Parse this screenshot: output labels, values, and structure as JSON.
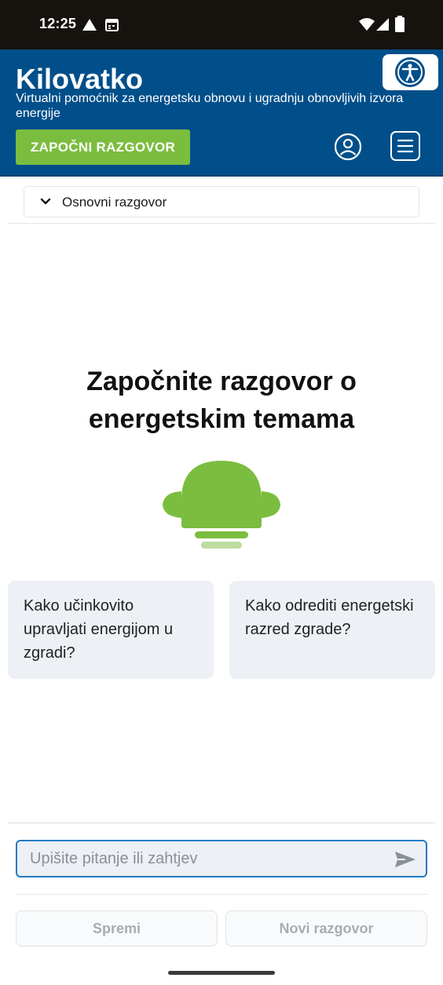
{
  "status_bar": {
    "time": "12:25",
    "left_icons": [
      "navigation-arrow-icon",
      "calendar-icon"
    ],
    "right_icons": [
      "wifi-icon",
      "signal-icon",
      "battery-icon"
    ]
  },
  "header": {
    "title": "Kilovatko",
    "subtitle": "Virtualni pomoćnik za energetsku obnovu i ugradnju obnovljivih izvora energije",
    "start_button": "ZAPOČNI RAZGOVOR",
    "icons": [
      "accessibility-icon",
      "user-icon",
      "menu-icon"
    ],
    "colors": {
      "header_bg": "#014f8a",
      "accent_green": "#7bbd3f"
    }
  },
  "conversation_selector": {
    "selected": "Osnovni razgovor"
  },
  "main": {
    "headline": "Započnite razgovor o energetskim temama",
    "suggestions": [
      "Kako učinkovito upravljati energijom u zgradi?",
      "Kako odrediti energetski razred zgrade?"
    ]
  },
  "composer": {
    "placeholder": "Upišite pitanje ili zahtjev",
    "value": "",
    "save_label": "Spremi",
    "new_label": "Novi razgovor"
  }
}
